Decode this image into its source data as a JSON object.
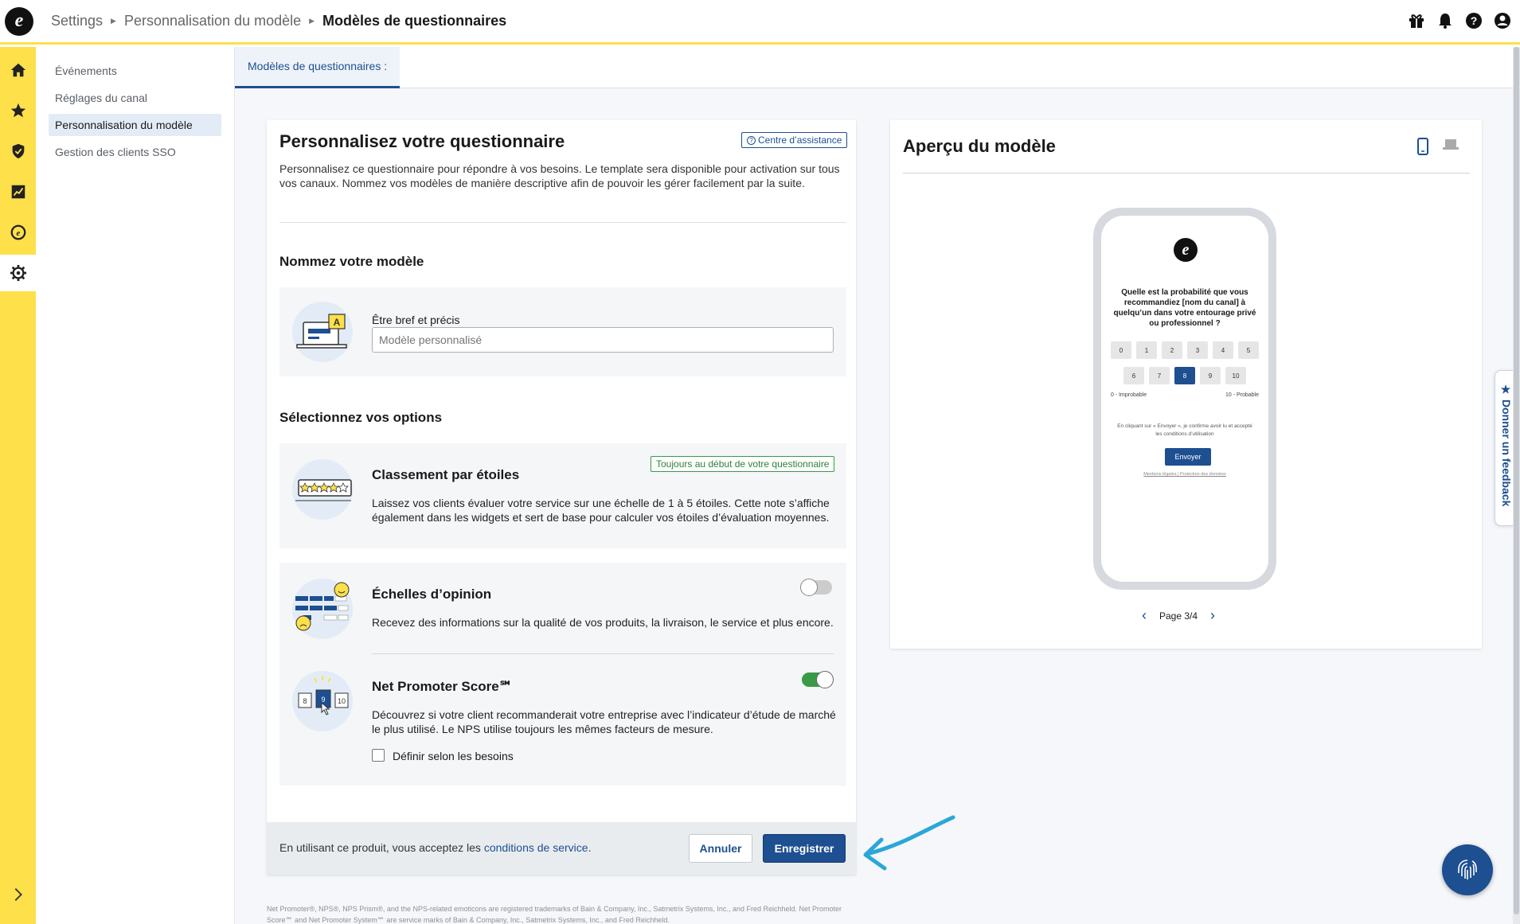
{
  "breadcrumb": [
    "Settings",
    "Personnalisation du modèle",
    "Modèles de questionnaires"
  ],
  "logo_letter": "e",
  "top_icons": [
    "gift-icon",
    "bell-icon",
    "help-icon",
    "user-icon"
  ],
  "rail_icons": [
    "home-icon",
    "star-icon",
    "shield-icon",
    "chart-icon",
    "e-badge-icon",
    "gear-icon",
    "chevron-right-icon"
  ],
  "subnav": {
    "items": [
      "Événements",
      "Réglages du canal",
      "Personnalisation du modèle",
      "Gestion des clients SSO"
    ],
    "active_index": 2
  },
  "tab": {
    "label": "Modèles de questionnaires :"
  },
  "form": {
    "title": "Personnalisez votre questionnaire",
    "help_link": "Centre d’assistance",
    "intro": "Personnalisez ce questionnaire pour répondre à vos besoins. Le template sera disponible pour activation sur tous vos canaux. Nommez vos modèles de manière descriptive afin de pouvoir les gérer facilement par la suite.",
    "name_section_title": "Nommez votre modèle",
    "name_label": "Être bref et précis",
    "name_placeholder": "Modèle personnalisé",
    "options_title": "Sélectionnez vos options",
    "options": [
      {
        "title": "Classement par étoiles",
        "badge": "Toujours au début de votre questionnaire",
        "desc": "Laissez vos clients évaluer votre service sur une échelle de 1 à 5 étoiles. Cette note s’affiche également dans les widgets et sert de base pour calculer vos étoiles d’évaluation moyennes."
      },
      {
        "title": "Échelles d’opinion",
        "toggle_on": false,
        "desc": "Recevez des informations sur la qualité de vos produits, la livraison, le service et plus encore."
      },
      {
        "title": "Net Promoter Score℠",
        "toggle_on": true,
        "desc": "Découvrez si votre client recommanderait votre entreprise avec l’indicateur d’étude de marché le plus utilisé. Le NPS utilise toujours les mêmes facteurs de mesure.",
        "checkbox_label": "Définir selon les besoins",
        "checkbox_checked": false,
        "illustration_numbers": [
          "8",
          "9",
          "10"
        ]
      }
    ],
    "footer_text": "En utilisant ce produit, vous acceptez les",
    "footer_link": "conditions de service",
    "footer_suffix": ".",
    "cancel": "Annuler",
    "save": "Enregistrer"
  },
  "legal": "Net Promoter®, NPS®, NPS Prism®, and the NPS-related emoticons are registered trademarks of Bain & Company, Inc., Satmetrix Systems, Inc., and Fred Reichheld. Net Promoter Score℠ and Net Promoter System℠ are service marks of Bain & Company, Inc., Satmetrix Systems, Inc., and Fred Reichheld.",
  "preview": {
    "title": "Aperçu du modèle",
    "question": "Quelle est la probabilité que vous recommandiez [nom du canal] à quelqu’un dans votre entourage privé ou professionnel ?",
    "row1": [
      "0",
      "1",
      "2",
      "3",
      "4",
      "5"
    ],
    "row2": [
      "6",
      "7",
      "8",
      "9",
      "10"
    ],
    "selected": "8",
    "low_label": "0 - Improbable",
    "high_label": "10 - Probable",
    "consent": "En cliquant sur « Envoyer », je confirme avoir lu et accepté les conditions d’utilisation",
    "button": "Envoyer",
    "footer": "Mentions légales | Protection des données",
    "page": "Page 3/4"
  },
  "feedback_tab": "Donner un feedback",
  "colors": {
    "brand_yellow": "#fde04a",
    "primary_blue": "#1d4f91",
    "success_green": "#3a9b47",
    "annotation_arrow": "#2aa7d6"
  }
}
